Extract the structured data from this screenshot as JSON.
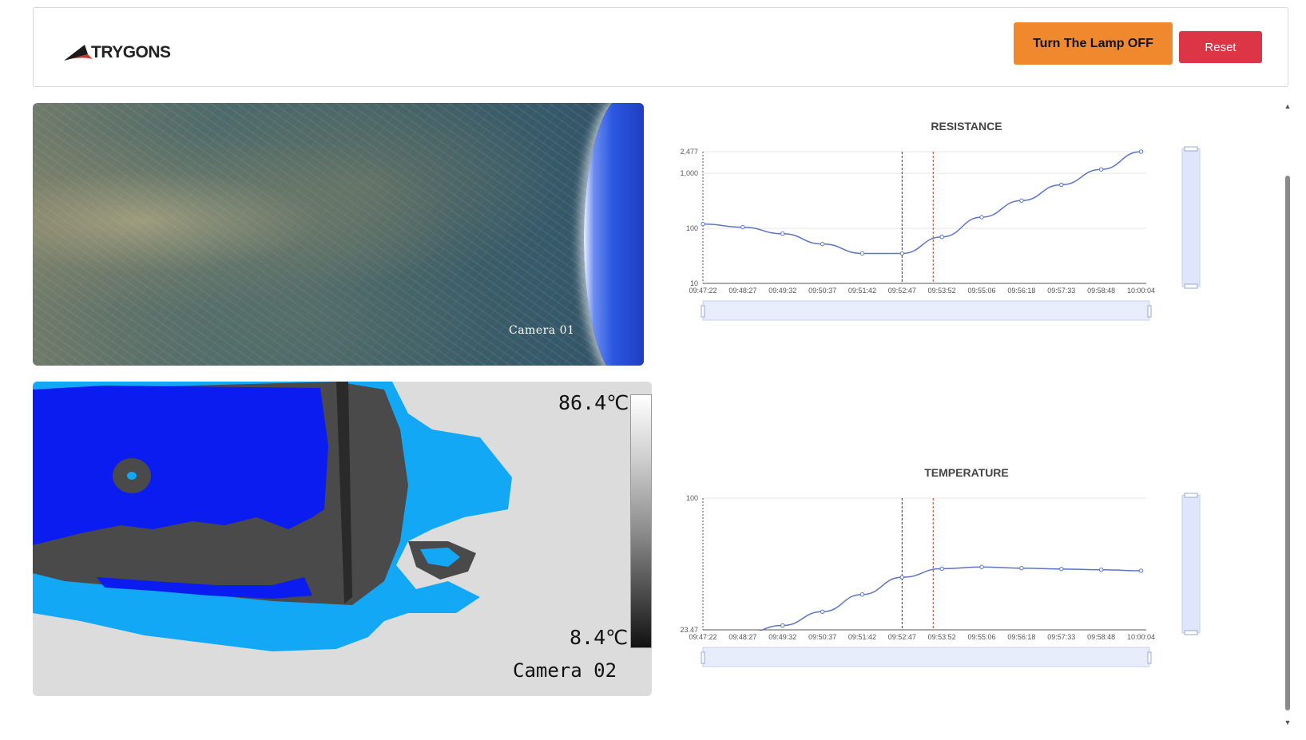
{
  "header": {
    "logo_text": "TRYGONS",
    "lamp_button_label": "Turn The Lamp OFF",
    "reset_button_label": "Reset"
  },
  "cameras": {
    "cam1_label": "Camera 01",
    "cam2_label": "Camera 02",
    "cam2_max_temp": "86.4℃",
    "cam2_min_temp": "8.4℃"
  },
  "colors": {
    "accent_orange": "#f0892e",
    "danger_red": "#dc3545",
    "series_blue": "#5b73c9",
    "marker_navy": "#2a2f8f",
    "marker_red": "#c0392b",
    "thermal_blue": "#0a1cf0",
    "thermal_cyan": "#12a8f5"
  },
  "chart_data": [
    {
      "type": "line",
      "title": "RESISTANCE",
      "yscale": "log",
      "ylim": [
        10,
        2477
      ],
      "ytick_labels": [
        "2,477",
        "1,000",
        "100",
        "10"
      ],
      "ytick_values": [
        2477,
        1000,
        100,
        10
      ],
      "categories": [
        "09:47:22",
        "09:48:27",
        "09:49:32",
        "09:50:37",
        "09:51:42",
        "09:52:47",
        "09:53:52",
        "09:55:06",
        "09:56:18",
        "09:57:33",
        "09:58:48",
        "10:00:04"
      ],
      "series": [
        {
          "values": [
            120,
            105,
            80,
            52,
            35,
            35,
            70,
            160,
            320,
            620,
            1180,
            2477
          ]
        }
      ],
      "markers": [
        "09:52:47",
        "09:53:25"
      ],
      "grid": true,
      "legend": "none"
    },
    {
      "type": "line",
      "title": "TEMPERATURE",
      "ylim": [
        23.47,
        100
      ],
      "ytick_labels": [
        "100",
        "23.47"
      ],
      "ytick_values": [
        100,
        23.47
      ],
      "categories": [
        "09:47:22",
        "09:48:27",
        "09:49:32",
        "09:50:37",
        "09:51:42",
        "09:52:47",
        "09:53:52",
        "09:55:06",
        "09:56:18",
        "09:57:33",
        "09:58:48",
        "10:00:04"
      ],
      "series": [
        {
          "values": [
            19,
            21,
            26,
            34,
            44,
            54,
            59,
            60,
            59.3,
            58.8,
            58.4,
            57.8
          ]
        }
      ],
      "markers": [
        "09:52:47",
        "09:53:25"
      ],
      "grid": true,
      "legend": "none"
    }
  ]
}
